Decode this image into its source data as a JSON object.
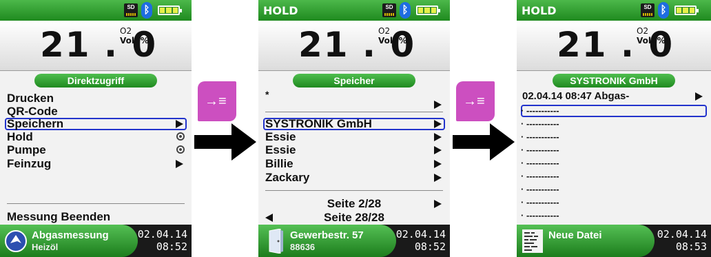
{
  "screens": [
    {
      "hold_label": "",
      "reading": {
        "value": "21.0",
        "gas": "O2",
        "unit": "Vol. %"
      },
      "header_pill": "Direktzugriff",
      "items": [
        {
          "label": "Drucken",
          "control": "none"
        },
        {
          "label": "QR-Code",
          "control": "none"
        },
        {
          "label": "Speichern",
          "control": "arrow",
          "selected": true
        },
        {
          "label": "Hold",
          "control": "radio"
        },
        {
          "label": "Pumpe",
          "control": "radio"
        },
        {
          "label": "Feinzug",
          "control": "arrow"
        }
      ],
      "footer_item": "Messung Beenden",
      "bottom": {
        "line1": "Abgasmessung",
        "line2": "Heizöl",
        "date": "02.04.14",
        "time": "08:52",
        "icon": "globe-icon"
      }
    },
    {
      "hold_label": "HOLD",
      "reading": {
        "value": "21.0",
        "gas": "O2",
        "unit": "Vol. %"
      },
      "header_pill": "Speicher",
      "star_item": "*",
      "items": [
        {
          "label": "SYSTRONIK GmbH",
          "control": "arrow",
          "selected": true
        },
        {
          "label": "Essie",
          "control": "arrow"
        },
        {
          "label": "Essie",
          "control": "arrow"
        },
        {
          "label": "Billie",
          "control": "arrow"
        },
        {
          "label": "Zackary",
          "control": "arrow"
        }
      ],
      "page_next": "Seite 2/28",
      "page_prev": "Seite 28/28",
      "bottom": {
        "line1": "Gewerbestr. 57",
        "line2": "88636",
        "date": "02.04.14",
        "time": "08:52",
        "icon": "door-icon"
      }
    },
    {
      "hold_label": "HOLD",
      "reading": {
        "value": "21.0",
        "gas": "O2",
        "unit": "Vol. %"
      },
      "header_pill": "SYSTRONIK GmbH",
      "first_item": "02.04.14 08:47 Abgas-",
      "empty_label": "-----------",
      "empty_count": 9,
      "bottom": {
        "line1": "Neue Datei",
        "line2": "",
        "date": "02.04.14",
        "time": "08:53",
        "icon": "qr-code-icon"
      }
    }
  ],
  "status_icons": [
    "sd-card-icon",
    "bluetooth-icon",
    "battery-icon"
  ],
  "sd_label": "SD",
  "colors": {
    "green": "#2a9a2a",
    "selection": "#2233cc",
    "pink": "#cc4fc0"
  }
}
